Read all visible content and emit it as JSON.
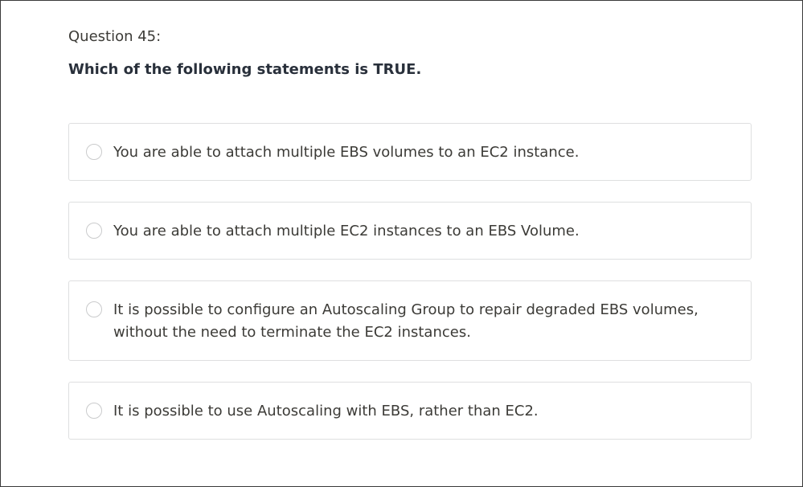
{
  "question": {
    "number_label": "Question 45:",
    "prompt": "Which of the following statements is TRUE."
  },
  "options": [
    {
      "text": "You are able to attach multiple EBS volumes to an EC2 instance.",
      "selected": false
    },
    {
      "text": "You are able to attach multiple EC2 instances to an EBS Volume.",
      "selected": false
    },
    {
      "text": "It is possible to configure an Autoscaling Group to repair degraded EBS volumes, without the need to terminate the EC2 instances.",
      "selected": false
    },
    {
      "text": "It is possible to use Autoscaling with EBS, rather than EC2.",
      "selected": false
    }
  ],
  "colors": {
    "text": "#3c3b37",
    "prompt": "#29303b",
    "border": "#dedfe0",
    "radio_border": "#cacbcc",
    "frame_border": "#3a3a3a"
  }
}
